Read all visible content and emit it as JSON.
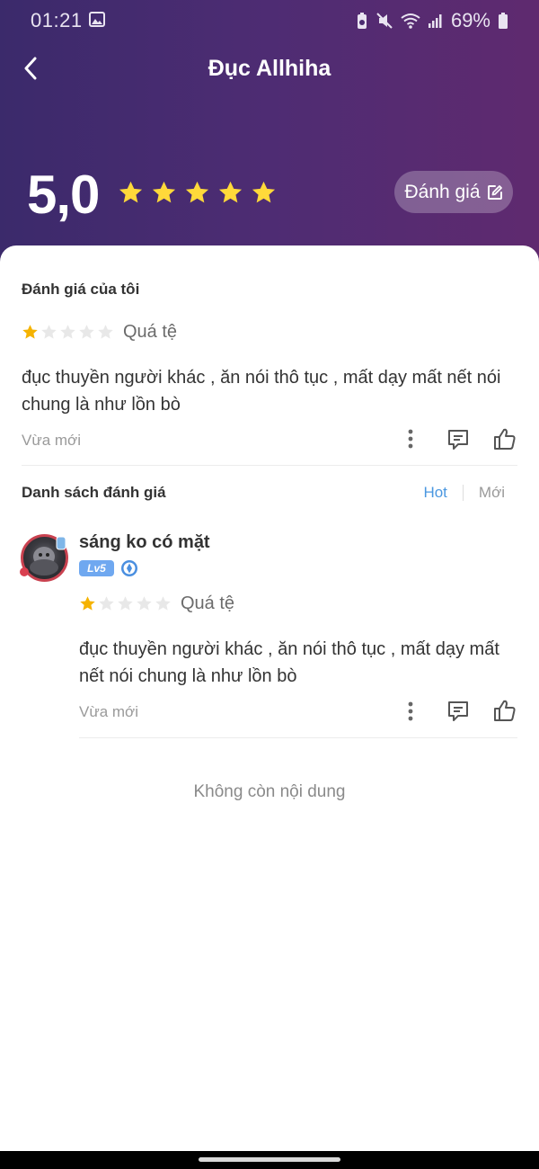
{
  "status_bar": {
    "time": "01:21",
    "battery": "69%"
  },
  "header": {
    "title": "Đục Allhiha"
  },
  "summary": {
    "score": "5,0",
    "stars_filled": 5,
    "stars_total": 5,
    "rate_button_label": "Đánh giá"
  },
  "my_review": {
    "section_title": "Đánh giá của tôi",
    "stars_filled": 1,
    "stars_total": 5,
    "rating_label": "Quá tệ",
    "text": "đục thuyền người khác , ăn nói thô tục , mất dạy mất nết nói chung là như lồn bò",
    "time": "Vừa mới"
  },
  "reviews_list": {
    "section_title": "Danh sách đánh giá",
    "tabs": [
      {
        "label": "Hot",
        "active": true
      },
      {
        "label": "Mới",
        "active": false
      }
    ],
    "items": [
      {
        "username": "sáng ko có mặt",
        "level": "Lv5",
        "stars_filled": 1,
        "stars_total": 5,
        "rating_label": "Quá tệ",
        "text": "đục thuyền người khác , ăn nói thô tục , mất dạy mất nết nói chung là như lồn bò",
        "time": "Vừa mới"
      }
    ],
    "end_text": "Không còn nội dung"
  },
  "icons": {
    "back": "chevron-left-icon",
    "edit": "edit-icon",
    "more": "more-vertical-icon",
    "comment": "comment-icon",
    "like": "thumbs-up-icon"
  },
  "colors": {
    "star": "#ffd93a",
    "star_small": "#f5b301",
    "star_empty": "#e8e8e8",
    "tab_active": "#4a97e0",
    "level_badge": "#6fa8f0"
  }
}
